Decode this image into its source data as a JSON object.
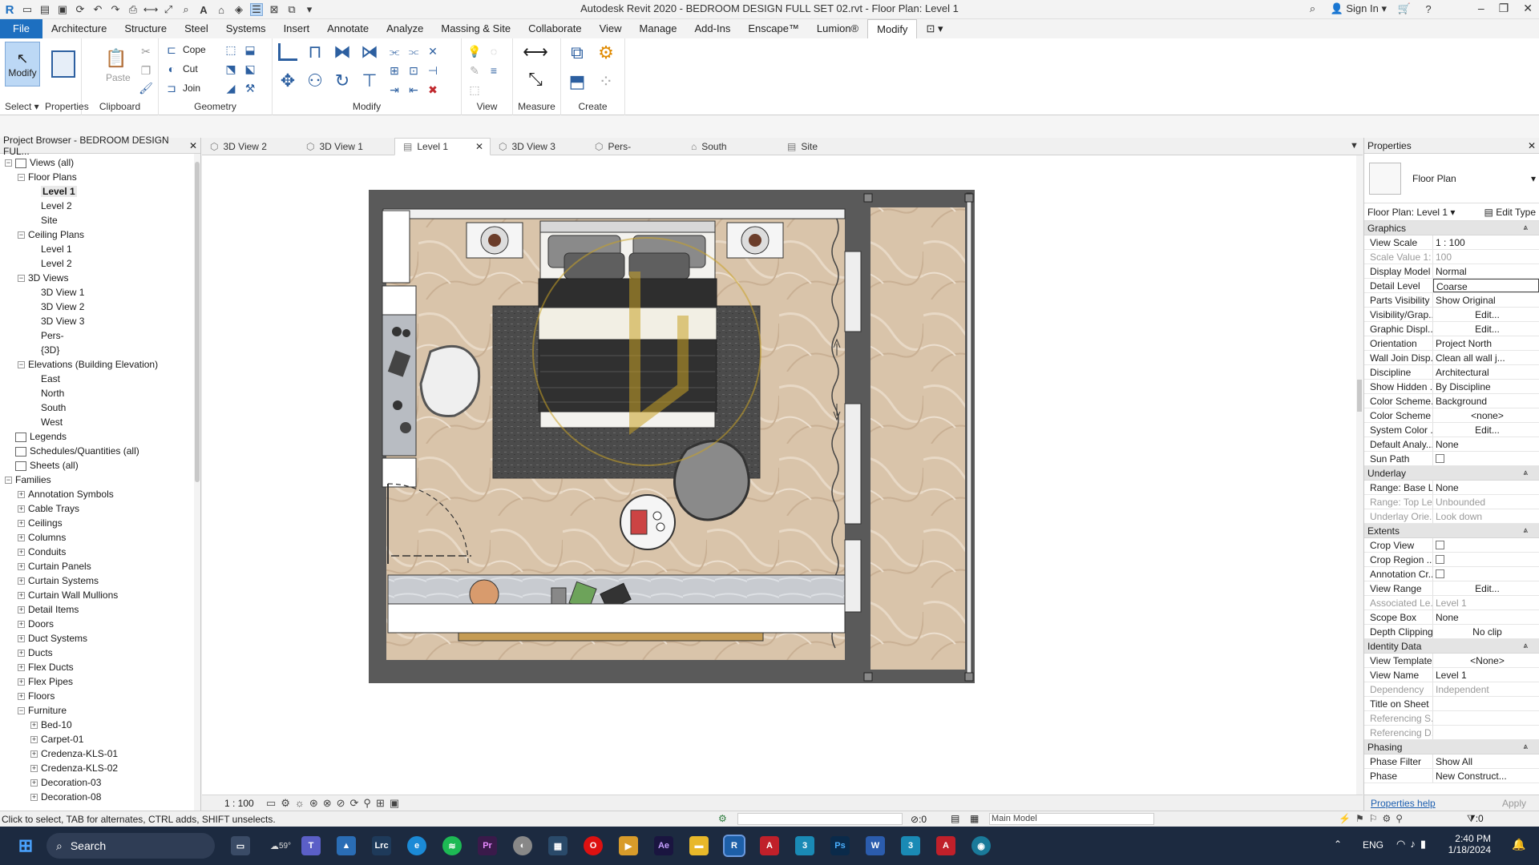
{
  "window": {
    "title": "Autodesk Revit 2020 - BEDROOM DESIGN FULL SET 02.rvt - Floor Plan: Level 1",
    "sign_in": "Sign In"
  },
  "menu_tabs": [
    "File",
    "Architecture",
    "Structure",
    "Steel",
    "Systems",
    "Insert",
    "Annotate",
    "Analyze",
    "Massing & Site",
    "Collaborate",
    "View",
    "Manage",
    "Add-Ins",
    "Enscape™",
    "Lumion®",
    "Modify"
  ],
  "active_tab": "Modify",
  "ribbon": {
    "modify_label": "Modify",
    "select_label": "Select ▾",
    "properties_label": "Properties",
    "paste_label": "Paste",
    "clipboard_label": "Clipboard",
    "cope_label": "Cope",
    "cut_label": "Cut",
    "join_label": "Join",
    "geometry_label": "Geometry",
    "modify_panel_label": "Modify",
    "view_label": "View",
    "measure_label": "Measure",
    "create_label": "Create"
  },
  "browser": {
    "title": "Project Browser - BEDROOM DESIGN FUL...",
    "items": [
      {
        "label": "Views (all)",
        "level": 0,
        "toggle": "−",
        "icon": true
      },
      {
        "label": "Floor Plans",
        "level": 1,
        "toggle": "−"
      },
      {
        "label": "Level 1",
        "level": 2,
        "selected": true
      },
      {
        "label": "Level 2",
        "level": 2
      },
      {
        "label": "Site",
        "level": 2
      },
      {
        "label": "Ceiling Plans",
        "level": 1,
        "toggle": "−"
      },
      {
        "label": "Level 1",
        "level": 2
      },
      {
        "label": "Level 2",
        "level": 2
      },
      {
        "label": "3D Views",
        "level": 1,
        "toggle": "−"
      },
      {
        "label": "3D View 1",
        "level": 2
      },
      {
        "label": "3D View 2",
        "level": 2
      },
      {
        "label": "3D View 3",
        "level": 2
      },
      {
        "label": "Pers-",
        "level": 2
      },
      {
        "label": "{3D}",
        "level": 2
      },
      {
        "label": "Elevations (Building Elevation)",
        "level": 1,
        "toggle": "−"
      },
      {
        "label": "East",
        "level": 2
      },
      {
        "label": "North",
        "level": 2
      },
      {
        "label": "South",
        "level": 2
      },
      {
        "label": "West",
        "level": 2
      },
      {
        "label": "Legends",
        "level": 0,
        "icon": true
      },
      {
        "label": "Schedules/Quantities (all)",
        "level": 0,
        "icon": true
      },
      {
        "label": "Sheets (all)",
        "level": 0,
        "icon": true
      },
      {
        "label": "Families",
        "level": 0,
        "toggle": "−"
      },
      {
        "label": "Annotation Symbols",
        "level": 1,
        "toggle": "+"
      },
      {
        "label": "Cable Trays",
        "level": 1,
        "toggle": "+"
      },
      {
        "label": "Ceilings",
        "level": 1,
        "toggle": "+"
      },
      {
        "label": "Columns",
        "level": 1,
        "toggle": "+"
      },
      {
        "label": "Conduits",
        "level": 1,
        "toggle": "+"
      },
      {
        "label": "Curtain Panels",
        "level": 1,
        "toggle": "+"
      },
      {
        "label": "Curtain Systems",
        "level": 1,
        "toggle": "+"
      },
      {
        "label": "Curtain Wall Mullions",
        "level": 1,
        "toggle": "+"
      },
      {
        "label": "Detail Items",
        "level": 1,
        "toggle": "+"
      },
      {
        "label": "Doors",
        "level": 1,
        "toggle": "+"
      },
      {
        "label": "Duct Systems",
        "level": 1,
        "toggle": "+"
      },
      {
        "label": "Ducts",
        "level": 1,
        "toggle": "+"
      },
      {
        "label": "Flex Ducts",
        "level": 1,
        "toggle": "+"
      },
      {
        "label": "Flex Pipes",
        "level": 1,
        "toggle": "+"
      },
      {
        "label": "Floors",
        "level": 1,
        "toggle": "+"
      },
      {
        "label": "Furniture",
        "level": 1,
        "toggle": "−"
      },
      {
        "label": "Bed-10",
        "level": 2,
        "toggle": "+"
      },
      {
        "label": "Carpet-01",
        "level": 2,
        "toggle": "+"
      },
      {
        "label": "Credenza-KLS-01",
        "level": 2,
        "toggle": "+"
      },
      {
        "label": "Credenza-KLS-02",
        "level": 2,
        "toggle": "+"
      },
      {
        "label": "Decoration-03",
        "level": 2,
        "toggle": "+"
      },
      {
        "label": "Decoration-08",
        "level": 2,
        "toggle": "+"
      }
    ]
  },
  "view_tabs": [
    {
      "label": "3D View 2",
      "active": false
    },
    {
      "label": "3D View 1",
      "active": false
    },
    {
      "label": "Level 1",
      "active": true
    },
    {
      "label": "3D View 3",
      "active": false
    },
    {
      "label": "Pers-",
      "active": false
    },
    {
      "label": "South",
      "active": false
    },
    {
      "label": "Site",
      "active": false
    }
  ],
  "view_bar": {
    "scale": "1 : 100"
  },
  "properties": {
    "title": "Properties",
    "family_type": "Floor Plan",
    "instance": "Floor Plan: Level 1",
    "edit_type": "Edit Type",
    "groups": [
      {
        "name": "Graphics",
        "rows": [
          {
            "n": "View Scale",
            "v": "1 : 100"
          },
          {
            "n": "Scale Value    1:",
            "v": "100",
            "dis": true
          },
          {
            "n": "Display Model",
            "v": "Normal"
          },
          {
            "n": "Detail Level",
            "v": "Coarse",
            "boxed": true
          },
          {
            "n": "Parts Visibility",
            "v": "Show Original"
          },
          {
            "n": "Visibility/Grap...",
            "v": "Edit...",
            "btn": true
          },
          {
            "n": "Graphic Displ...",
            "v": "Edit...",
            "btn": true
          },
          {
            "n": "Orientation",
            "v": "Project North"
          },
          {
            "n": "Wall Join Disp...",
            "v": "Clean all wall j..."
          },
          {
            "n": "Discipline",
            "v": "Architectural"
          },
          {
            "n": "Show Hidden ...",
            "v": "By Discipline"
          },
          {
            "n": "Color Scheme...",
            "v": "Background"
          },
          {
            "n": "Color Scheme",
            "v": "<none>",
            "btn": true
          },
          {
            "n": "System Color ...",
            "v": "Edit...",
            "btn": true
          },
          {
            "n": "Default Analy...",
            "v": "None"
          },
          {
            "n": "Sun Path",
            "v": "",
            "check": true
          }
        ]
      },
      {
        "name": "Underlay",
        "rows": [
          {
            "n": "Range: Base L...",
            "v": "None"
          },
          {
            "n": "Range: Top Le...",
            "v": "Unbounded",
            "dis": true
          },
          {
            "n": "Underlay Orie...",
            "v": "Look down",
            "dis": true
          }
        ]
      },
      {
        "name": "Extents",
        "rows": [
          {
            "n": "Crop View",
            "v": "",
            "check": true
          },
          {
            "n": "Crop Region ...",
            "v": "",
            "check": true
          },
          {
            "n": "Annotation Cr...",
            "v": "",
            "check": true
          },
          {
            "n": "View Range",
            "v": "Edit...",
            "btn": true
          },
          {
            "n": "Associated Le...",
            "v": "Level 1",
            "dis": true
          },
          {
            "n": "Scope Box",
            "v": "None"
          },
          {
            "n": "Depth Clipping",
            "v": "No clip",
            "btn": true
          }
        ]
      },
      {
        "name": "Identity Data",
        "rows": [
          {
            "n": "View Template",
            "v": "<None>",
            "btn": true
          },
          {
            "n": "View Name",
            "v": "Level 1"
          },
          {
            "n": "Dependency",
            "v": "Independent",
            "dis": true
          },
          {
            "n": "Title on Sheet",
            "v": ""
          },
          {
            "n": "Referencing S...",
            "v": "",
            "dis": true
          },
          {
            "n": "Referencing D...",
            "v": "",
            "dis": true
          }
        ]
      },
      {
        "name": "Phasing",
        "rows": [
          {
            "n": "Phase Filter",
            "v": "Show All"
          },
          {
            "n": "Phase",
            "v": "New Construct..."
          }
        ]
      }
    ],
    "help": "Properties help",
    "apply": "Apply"
  },
  "status": {
    "hint": "Click to select, TAB for alternates, CTRL adds, SHIFT unselects.",
    "filter_count": ":0",
    "model": "Main Model",
    "sel_count": ":0"
  },
  "taskbar": {
    "search": "Search",
    "temp": "59°",
    "lang": "ENG",
    "time": "2:40 PM",
    "date": "1/18/2024"
  },
  "colors": {
    "accent": "#1d6fc0",
    "floor": "#d8c3a8",
    "wall": "#555555",
    "rug": "#4a4a4a",
    "taskbar": "#1c2a40"
  }
}
